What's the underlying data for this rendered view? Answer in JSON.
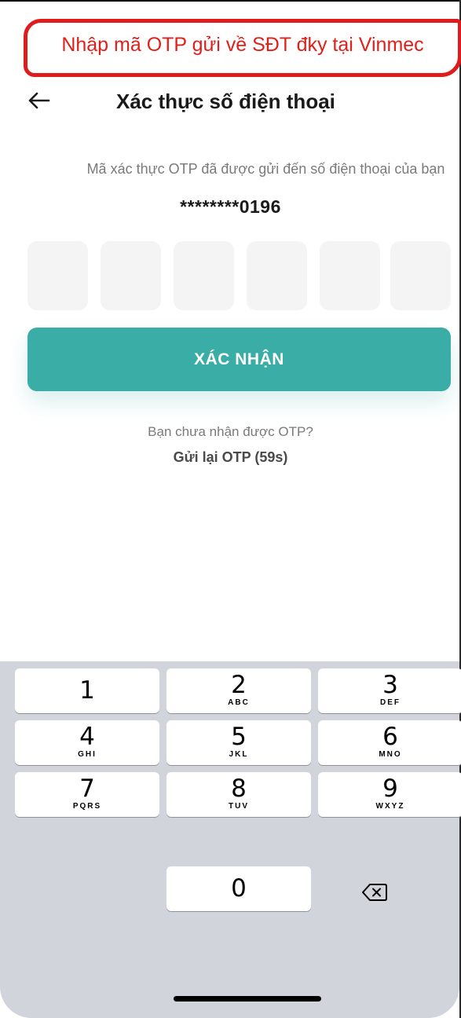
{
  "annotation": {
    "text": "Nhập mã OTP gửi về SĐT đky tại Vinmec",
    "color": "#e0201b"
  },
  "header": {
    "title": "Xác thực số điện thoại",
    "back_icon": "arrow-left-icon"
  },
  "verification": {
    "subtitle": "Mã xác thực OTP đã được gửi đến số điện thoại của bạn",
    "phone_masked": "********0196",
    "otp_digits": [
      "",
      "",
      "",
      "",
      "",
      ""
    ]
  },
  "confirm": {
    "label": "XÁC NHẬN",
    "color": "#39ada6"
  },
  "resend": {
    "question": "Bạn chưa nhận được OTP?",
    "link": "Gửi lại OTP (59s)"
  },
  "keypad": {
    "keys": [
      {
        "num": "1",
        "letters": ""
      },
      {
        "num": "2",
        "letters": "ABC"
      },
      {
        "num": "3",
        "letters": "DEF"
      },
      {
        "num": "4",
        "letters": "GHI"
      },
      {
        "num": "5",
        "letters": "JKL"
      },
      {
        "num": "6",
        "letters": "MNO"
      },
      {
        "num": "7",
        "letters": "PQRS"
      },
      {
        "num": "8",
        "letters": "TUV"
      },
      {
        "num": "9",
        "letters": "WXYZ"
      },
      {
        "num": "0",
        "letters": ""
      }
    ],
    "delete_icon": "backspace-icon"
  }
}
